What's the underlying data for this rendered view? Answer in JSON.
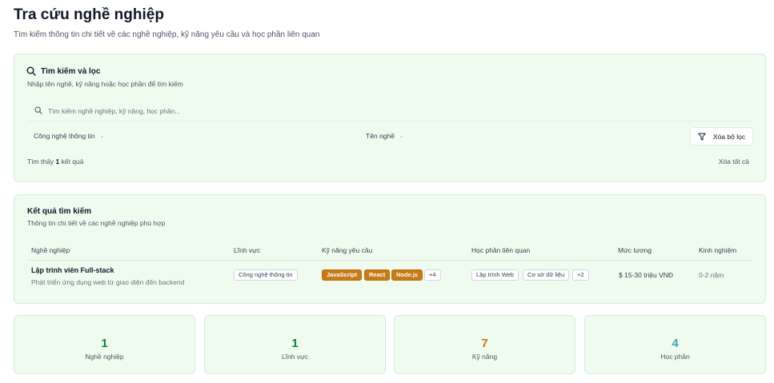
{
  "header": {
    "title": "Tra cứu nghề nghiệp",
    "subtitle": "Tìm kiếm thông tin chi tiết về các nghề nghiệp, kỹ năng yêu cầu và học phần liên quan"
  },
  "filter": {
    "title": "Tìm kiếm và lọc",
    "desc": "Nhập tên nghề, kỹ năng hoặc học phần để tìm kiếm",
    "search_placeholder": "Tìm kiếm nghề nghiệp, kỹ năng, học phần...",
    "search_value": "",
    "field_select": "Công nghệ thông tin",
    "sort_select": "Tên nghề",
    "clear_filters": "Xóa bộ lọc",
    "found_prefix": "Tìm thấy",
    "found_count": "1",
    "found_suffix": "kết quả",
    "clear_all": "Xóa tất cả"
  },
  "results": {
    "title": "Kết quả tìm kiếm",
    "desc": "Thông tin chi tiết về các nghề nghiệp phù hợp",
    "columns": [
      "Nghề nghiệp",
      "Lĩnh vực",
      "Kỹ năng yêu cầu",
      "Học phần liên quan",
      "Mức lương",
      "Kinh nghiệm"
    ],
    "rows": [
      {
        "name": "Lập trình viên Full-stack",
        "desc": "Phát triển ứng dụng web từ giao diện đến backend",
        "field": "Công nghệ thông tin",
        "skills": [
          "JavaScript",
          "React",
          "Node.js"
        ],
        "skills_more": "+4",
        "courses": [
          "Lập trình Web",
          "Cơ sở dữ liệu"
        ],
        "courses_more": "+2",
        "salary": "$ 15-30 triệu VNĐ",
        "experience": "0-2 năm"
      }
    ]
  },
  "stats": [
    {
      "value": "1",
      "label": "Nghề nghiệp",
      "color": "#15803d"
    },
    {
      "value": "1",
      "label": "Lĩnh vực",
      "color": "#15803d"
    },
    {
      "value": "7",
      "label": "Kỹ năng",
      "color": "#c2780f"
    },
    {
      "value": "4",
      "label": "Học phần",
      "color": "#3ea6b4"
    }
  ],
  "colors": {
    "card_bg": "#f0fbf0",
    "card_border": "#d6ecd6",
    "skill_tag": "#c77a16"
  },
  "icons": {
    "search": "search-icon",
    "filter": "filter-icon",
    "chevron": "chevron-down-icon"
  }
}
